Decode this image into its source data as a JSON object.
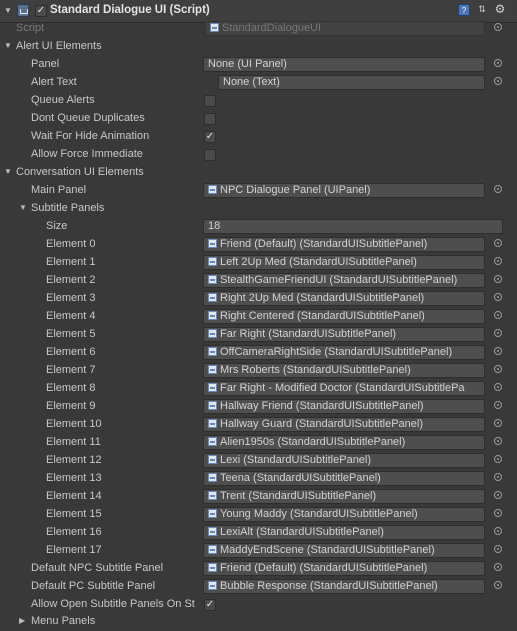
{
  "component": {
    "title": "Standard Dialogue UI (Script)",
    "enabled": true,
    "icons": [
      "script-icon",
      "help-book-icon",
      "settings-sliders-icon",
      "gear-icon"
    ]
  },
  "script": {
    "label": "Script",
    "value": "StandardDialogueUI"
  },
  "alert": {
    "section_label": "Alert UI Elements",
    "panel_label": "Panel",
    "panel_value": "None (UI Panel)",
    "alert_text_label": "Alert Text",
    "alert_text_value": "None (Text)",
    "queue_alerts_label": "Queue Alerts",
    "queue_alerts": false,
    "dont_queue_label": "Dont Queue Duplicates",
    "dont_queue": false,
    "wait_hide_label": "Wait For Hide Animation",
    "wait_hide": true,
    "allow_force_label": "Allow Force Immediate",
    "allow_force": false
  },
  "conversation": {
    "section_label": "Conversation UI Elements",
    "main_panel_label": "Main Panel",
    "main_panel_value": "NPC Dialogue Panel (UIPanel)",
    "subtitle_panels_label": "Subtitle Panels",
    "size_label": "Size",
    "size_value": "18",
    "elements": [
      {
        "label": "Element 0",
        "value": "Friend (Default) (StandardUISubtitlePanel)"
      },
      {
        "label": "Element 1",
        "value": "Left 2Up Med (StandardUISubtitlePanel)"
      },
      {
        "label": "Element 2",
        "value": "StealthGameFriendUI (StandardUISubtitlePanel)"
      },
      {
        "label": "Element 3",
        "value": "Right 2Up Med (StandardUISubtitlePanel)"
      },
      {
        "label": "Element 4",
        "value": "Right Centered (StandardUISubtitlePanel)"
      },
      {
        "label": "Element 5",
        "value": "Far Right (StandardUISubtitlePanel)"
      },
      {
        "label": "Element 6",
        "value": "OffCameraRightSide (StandardUISubtitlePanel)"
      },
      {
        "label": "Element 7",
        "value": "Mrs Roberts (StandardUISubtitlePanel)"
      },
      {
        "label": "Element 8",
        "value": "Far Right  - Modified Doctor (StandardUISubtitlePa"
      },
      {
        "label": "Element 9",
        "value": "Hallway Friend (StandardUISubtitlePanel)"
      },
      {
        "label": "Element 10",
        "value": "Hallway Guard (StandardUISubtitlePanel)"
      },
      {
        "label": "Element 11",
        "value": "Alien1950s (StandardUISubtitlePanel)"
      },
      {
        "label": "Element 12",
        "value": "Lexi (StandardUISubtitlePanel)"
      },
      {
        "label": "Element 13",
        "value": "Teena (StandardUISubtitlePanel)"
      },
      {
        "label": "Element 14",
        "value": "Trent (StandardUISubtitlePanel)"
      },
      {
        "label": "Element 15",
        "value": "Young Maddy (StandardUISubtitlePanel)"
      },
      {
        "label": "Element 16",
        "value": "LexiAlt (StandardUISubtitlePanel)"
      },
      {
        "label": "Element 17",
        "value": "MaddyEndScene (StandardUISubtitlePanel)"
      }
    ],
    "default_npc_label": "Default NPC Subtitle Panel",
    "default_npc_value": "Friend (Default) (StandardUISubtitlePanel)",
    "default_pc_label": "Default PC Subtitle Panel",
    "default_pc_value": "Bubble Response (StandardUISubtitlePanel)",
    "allow_open_label": "Allow Open Subtitle Panels On St",
    "allow_open": true,
    "menu_panels_label": "Menu Panels"
  }
}
